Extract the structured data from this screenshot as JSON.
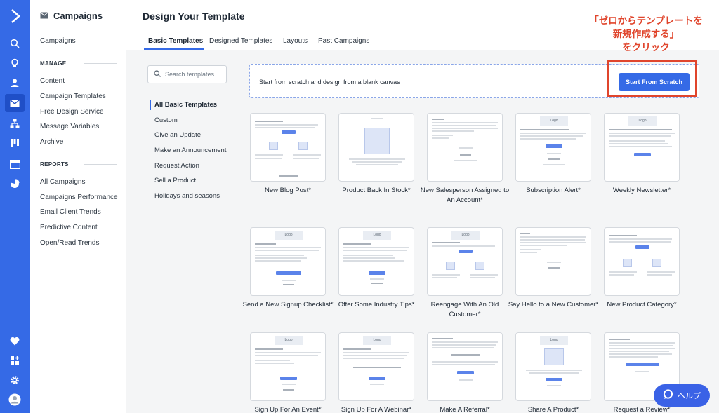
{
  "rail": {
    "icons": [
      "app-logo",
      "search-icon",
      "lightbulb-icon",
      "contacts-icon",
      "campaigns-icon",
      "automations-icon",
      "pipelines-icon",
      "website-icon",
      "reports-icon",
      "heart-icon",
      "apps-icon",
      "gear-icon",
      "user-avatar-icon"
    ],
    "accent": "#356ae6"
  },
  "sidebar": {
    "title": "Campaigns",
    "top_item": "Campaigns",
    "manage_label": "MANAGE",
    "manage_items": [
      "Content",
      "Campaign Templates",
      "Free Design Service",
      "Message Variables",
      "Archive"
    ],
    "reports_label": "REPORTS",
    "reports_items": [
      "All Campaigns",
      "Campaigns Performance",
      "Email Client Trends",
      "Predictive Content",
      "Open/Read Trends"
    ]
  },
  "header": {
    "title": "Design Your Template",
    "tabs": [
      "Basic Templates",
      "Designed Templates",
      "Layouts",
      "Past Campaigns"
    ],
    "active_tab": "Basic Templates"
  },
  "search": {
    "placeholder": "Search templates"
  },
  "categories": {
    "items": [
      "All Basic Templates",
      "Custom",
      "Give an Update",
      "Make an Announcement",
      "Request Action",
      "Sell a Product",
      "Holidays and seasons"
    ],
    "active": "All Basic Templates"
  },
  "scratch": {
    "text": "Start from scratch and design from a blank canvas",
    "button": "Start From Scratch"
  },
  "annotation": {
    "lines": [
      "「ゼロからテンプレートを",
      "新規作成する」",
      "をクリック"
    ],
    "color": "#e0452c"
  },
  "templates": [
    "New Blog Post*",
    "Product Back In Stock*",
    "New Salesperson Assigned to An Account*",
    "Subscription Alert*",
    "Weekly Newsletter*",
    "Send a New Signup Checklist*",
    "Offer Some Industry Tips*",
    "Reengage With An Old Customer*",
    "Say Hello to a New Customer*",
    "New Product Category*",
    "Sign Up For An Event*",
    "Sign Up For A Webinar*",
    "Make A Referral*",
    "Share A Product*",
    "Request a Review*"
  ],
  "help": {
    "label": "ヘルプ"
  }
}
